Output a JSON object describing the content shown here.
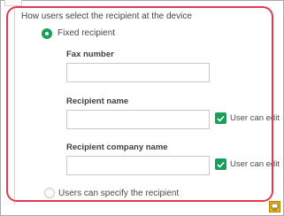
{
  "recipient_settings": {
    "heading": "How users select the recipient at the device",
    "options": {
      "fixed_recipient": {
        "label": "Fixed recipient",
        "selected": true
      },
      "user_specifies": {
        "label": "Users can specify the recipient",
        "selected": false
      }
    },
    "fields": {
      "fax_number": {
        "label": "Fax number",
        "value": ""
      },
      "recipient_name": {
        "label": "Recipient name",
        "value": "",
        "user_can_edit_label": "User can edit",
        "user_can_edit": true
      },
      "recipient_company_name": {
        "label": "Recipient company name",
        "value": "",
        "user_can_edit_label": "User can edit",
        "user_can_edit": true
      }
    }
  },
  "icons": [
    "radio-selected-icon",
    "radio-unselected-icon",
    "checkmark-icon",
    "resize-corner-icon"
  ],
  "colors": {
    "accent": "#17a05a",
    "highlight": "#e23a4e",
    "corner_icon": "#f4b400"
  }
}
